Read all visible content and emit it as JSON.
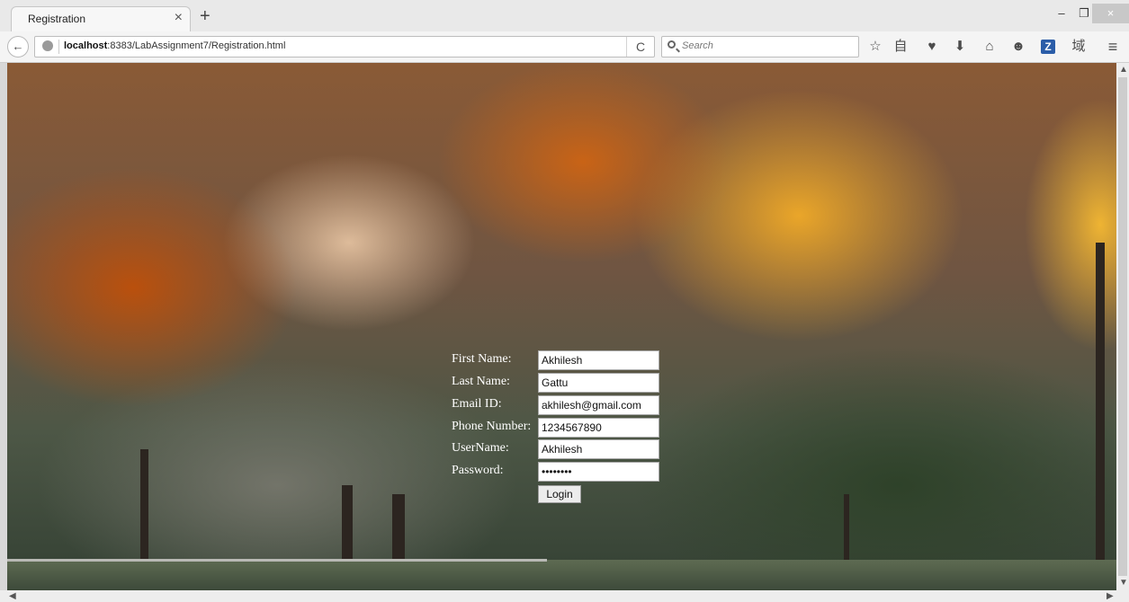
{
  "browser": {
    "tab_title": "Registration",
    "tab_close": "×",
    "new_tab": "+",
    "window": {
      "minimize": "–",
      "maximize": "❐",
      "close": "×"
    },
    "back": "←",
    "url_host": "localhost",
    "url_rest": ":8383/LabAssignment7/Registration.html",
    "reload": "C",
    "search_placeholder": "Search",
    "toolbar_icons": [
      {
        "name": "bookmark-star-icon",
        "glyph": "☆"
      },
      {
        "name": "reading-list-icon",
        "glyph": "自"
      },
      {
        "name": "pocket-icon",
        "glyph": "♥"
      },
      {
        "name": "download-icon",
        "glyph": "⬇"
      },
      {
        "name": "home-icon",
        "glyph": "⌂"
      },
      {
        "name": "chat-icon",
        "glyph": "☻"
      },
      {
        "name": "zotero-icon",
        "glyph": "Z"
      },
      {
        "name": "domain-icon",
        "glyph": "域"
      },
      {
        "name": "menu-icon",
        "glyph": "≡"
      }
    ]
  },
  "form": {
    "first_name_label": "First Name:",
    "first_name_value": "Akhilesh",
    "last_name_label": "Last Name:",
    "last_name_value": "Gattu",
    "email_label": "Email ID:",
    "email_value": "akhilesh@gmail.com",
    "phone_label": "Phone Number:",
    "phone_value": "1234567890",
    "username_label": "UserName:",
    "username_value": "Akhilesh",
    "password_label": "Password:",
    "password_value": "••••••••",
    "login_label": "Login"
  },
  "colors": {
    "label_text": "#ffffff",
    "field_bg": "#ffffff"
  }
}
